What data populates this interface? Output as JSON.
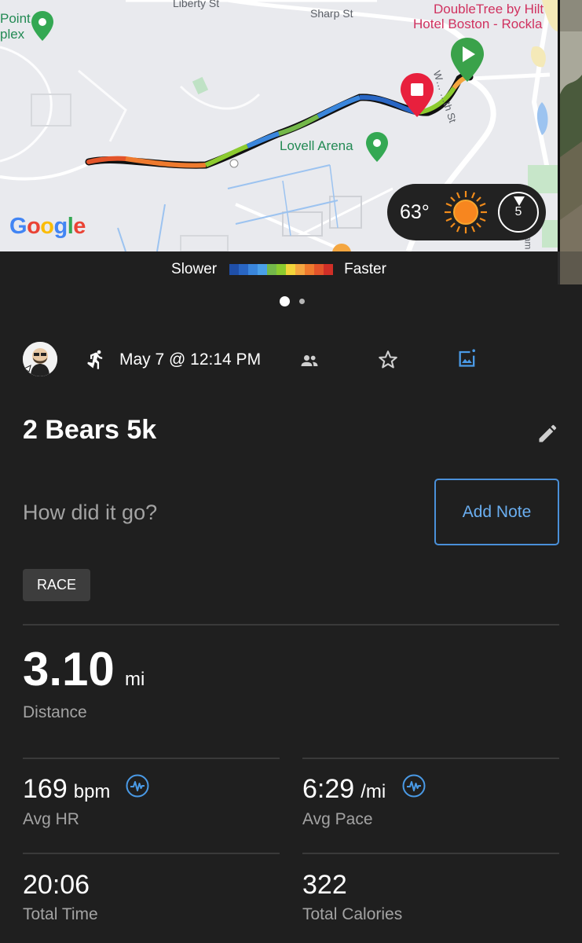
{
  "map": {
    "streets": {
      "liberty": "Liberty St",
      "sharp": "Sharp St",
      "washington": "W… …th St",
      "bottom_right_partial": "am"
    },
    "pois": {
      "point_complex": [
        "Point",
        "plex"
      ],
      "lovell_arena": "Lovell Arena",
      "doubletree": [
        "DoubleTree by Hilt",
        "Hotel Boston - Rockla"
      ]
    },
    "google_logo": [
      "G",
      "o",
      "o",
      "g",
      "l",
      "e"
    ],
    "google_colors": [
      "#4285f4",
      "#ea4335",
      "#fbbc05",
      "#4285f4",
      "#34a853",
      "#ea4335"
    ],
    "weather": {
      "temperature": "63°",
      "wind_speed": "5"
    }
  },
  "legend": {
    "slower": "Slower",
    "faster": "Faster",
    "colors": [
      "#1f4fa8",
      "#2966c4",
      "#3a86dc",
      "#4aa0e8",
      "#74b84a",
      "#8ccb2f",
      "#f2d43a",
      "#f4a640",
      "#ee7a2e",
      "#e3542a",
      "#d02f27"
    ]
  },
  "pager": {
    "pages": 2,
    "active": 1
  },
  "activity": {
    "date": "May 7 @ 12:14 PM",
    "title": "2 Bears 5k",
    "note_prompt": "How did it go?",
    "add_note": "Add Note",
    "badge": "RACE"
  },
  "stats": {
    "distance": {
      "value": "3.10",
      "unit": "mi",
      "label": "Distance"
    },
    "avg_hr": {
      "value": "169",
      "unit": "bpm",
      "label": "Avg HR"
    },
    "avg_pace": {
      "value": "6:29",
      "unit": "/mi",
      "label": "Avg Pace"
    },
    "total_time": {
      "value": "20:06",
      "label": "Total Time"
    },
    "total_calories": {
      "value": "322",
      "label": "Total Calories"
    }
  },
  "colors": {
    "background": "#1f1f1f",
    "accent_blue": "#4a90d9",
    "muted_text": "#a3a3a3",
    "start_marker": "#3aa24a",
    "stop_marker": "#e8203d"
  }
}
